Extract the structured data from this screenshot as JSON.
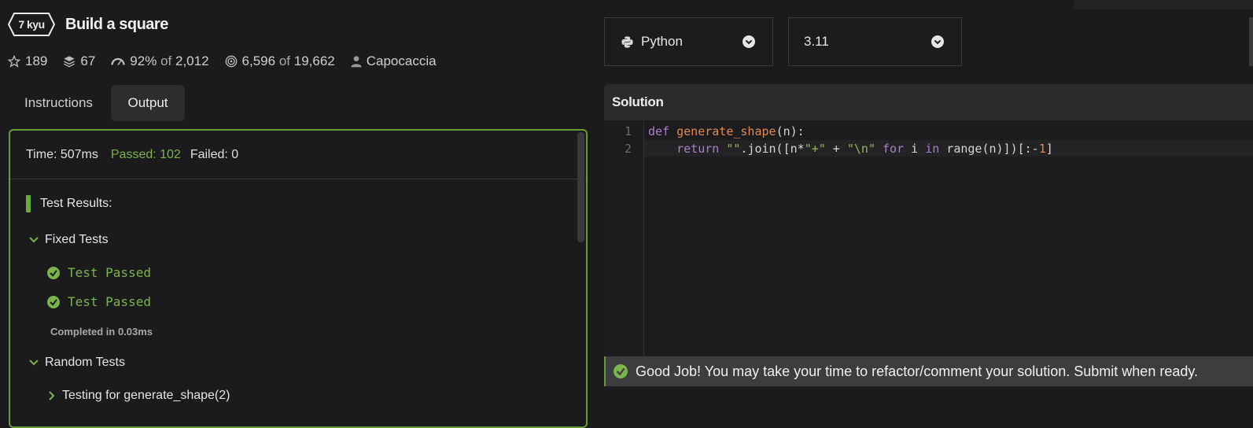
{
  "kata": {
    "rank": "7 kyu",
    "title": "Build a square",
    "stats": {
      "stars": "189",
      "collections": "67",
      "satisfaction_pct": "92%",
      "satisfaction_of": "of",
      "satisfaction_votes": "2,012",
      "completed": "6,596",
      "completed_of": "of",
      "attempted": "19,662",
      "author": "Capocaccia"
    }
  },
  "tabs": [
    {
      "label": "Instructions",
      "active": false
    },
    {
      "label": "Output",
      "active": true
    }
  ],
  "output": {
    "time": "Time: 507ms",
    "passed": "Passed: 102",
    "failed": "Failed: 0",
    "results_header": "Test Results:",
    "groups": {
      "fixed": "Fixed Tests",
      "random": "Random Tests"
    },
    "fixed_results": [
      "Test Passed",
      "Test Passed"
    ],
    "completed_in": "Completed in 0.03ms",
    "random_first_item": "Testing for generate_shape(2)"
  },
  "editor": {
    "language": "Python",
    "version": "3.11",
    "section_title": "Solution",
    "line_numbers": [
      "1",
      "2"
    ]
  },
  "banner": {
    "message": "Good Job! You may take your time to refactor/comment your solution. Submit when ready."
  },
  "colors": {
    "accent_green": "#7ab44a",
    "panel_border": "#6a9a34",
    "background": "#1b1b1d"
  },
  "icons": [
    "star-icon",
    "layers-icon",
    "speedometer-icon",
    "target-icon",
    "user-icon",
    "chevron-down-icon",
    "check-circle-icon",
    "python-icon"
  ]
}
